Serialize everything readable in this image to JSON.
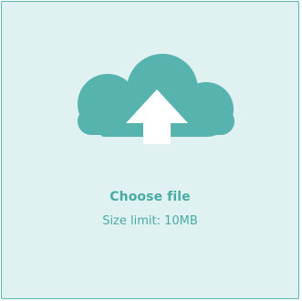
{
  "upload": {
    "title": "Choose file",
    "size_limit": "Size limit: 10MB",
    "icon": "cloud-upload-icon",
    "colors": {
      "background": "#dff1f1",
      "border": "#5ab5b0",
      "accent": "#56b3ae",
      "text": "#47aaa5"
    }
  }
}
